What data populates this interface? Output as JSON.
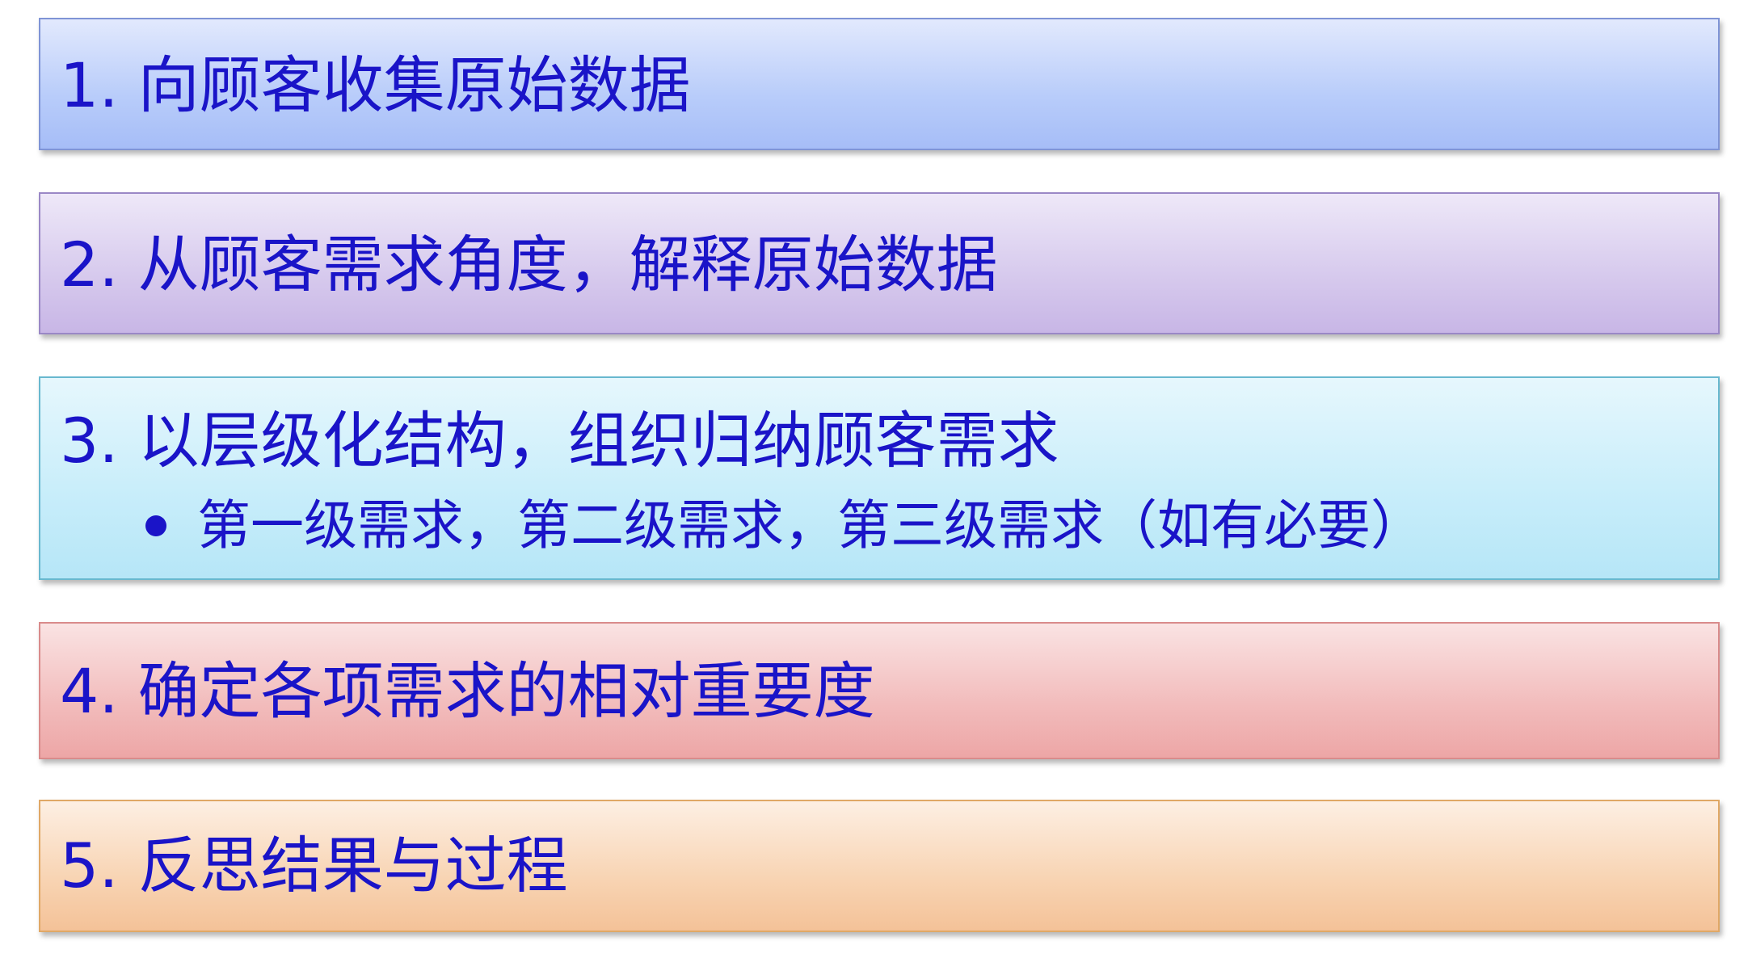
{
  "steps": [
    {
      "text": "1. 向顾客收集原始数据"
    },
    {
      "text": "2. 从顾客需求角度，解释原始数据"
    },
    {
      "text": "3. 以层级化结构，组织归纳顾客需求",
      "sub_items": [
        "第一级需求，第二级需求，第三级需求（如有必要）"
      ]
    },
    {
      "text": "4. 确定各项需求的相对重要度"
    },
    {
      "text": "5. 反思结果与过程"
    }
  ],
  "colors": {
    "text": "#1a14c8",
    "step1": "#b8ccfa",
    "step2": "#d6c9ed",
    "step3": "#c7edfa",
    "step4": "#f2bcbc",
    "step5": "#f8d4b3"
  }
}
